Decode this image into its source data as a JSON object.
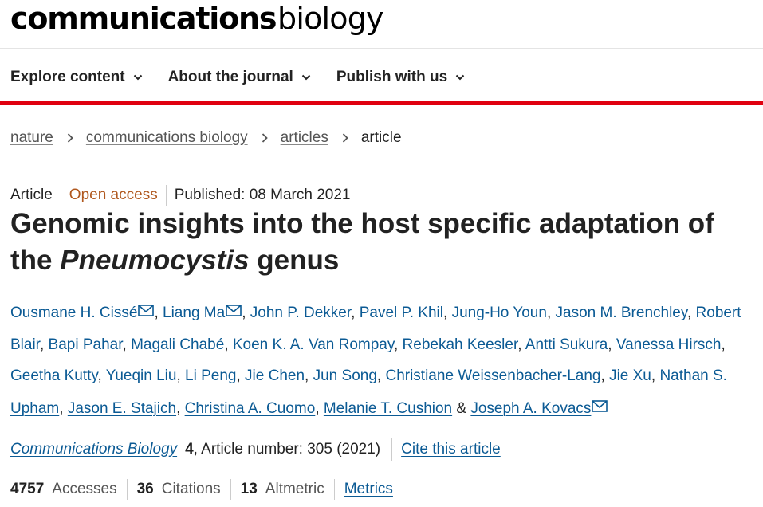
{
  "brand": {
    "bold": "communications",
    "light": "biology"
  },
  "menu": [
    {
      "label": "Explore content"
    },
    {
      "label": "About the journal"
    },
    {
      "label": "Publish with us"
    }
  ],
  "breadcrumb": [
    "nature",
    "communications biology",
    "articles",
    "article"
  ],
  "meta": {
    "type": "Article",
    "access": "Open access",
    "published": "Published: 08 March 2021"
  },
  "title": {
    "before": "Genomic insights into the host specific adaptation of the ",
    "italic": "Pneumocystis",
    "after": " genus"
  },
  "authors": [
    {
      "name": "Ousmane H. Cissé",
      "mail": true
    },
    {
      "name": "Liang Ma",
      "mail": true
    },
    {
      "name": "John P. Dekker"
    },
    {
      "name": "Pavel P. Khil"
    },
    {
      "name": "Jung-Ho Youn"
    },
    {
      "name": "Jason M. Brenchley"
    },
    {
      "name": "Robert Blair"
    },
    {
      "name": "Bapi Pahar"
    },
    {
      "name": "Magali Chabé"
    },
    {
      "name": "Koen K. A. Van Rompay"
    },
    {
      "name": "Rebekah Keesler"
    },
    {
      "name": "Antti Sukura"
    },
    {
      "name": "Vanessa Hirsch"
    },
    {
      "name": "Geetha Kutty"
    },
    {
      "name": "Yueqin Liu"
    },
    {
      "name": "Li Peng"
    },
    {
      "name": "Jie Chen"
    },
    {
      "name": "Jun Song"
    },
    {
      "name": "Christiane Weissenbacher-Lang"
    },
    {
      "name": "Jie Xu"
    },
    {
      "name": "Nathan S. Upham"
    },
    {
      "name": "Jason E. Stajich"
    },
    {
      "name": "Christina A. Cuomo"
    },
    {
      "name": "Melanie T. Cushion"
    },
    {
      "name": "Joseph A. Kovacs",
      "mail": true
    }
  ],
  "citation": {
    "journal": "Communications Biology",
    "volume": "4",
    "article_number": ", Article number: 305 (2021)",
    "cite_label": "Cite this article"
  },
  "metrics": {
    "accesses": "4757",
    "accesses_label": "Accesses",
    "citations": "36",
    "citations_label": "Citations",
    "altmetric": "13",
    "altmetric_label": "Altmetric",
    "metrics_label": "Metrics"
  },
  "colors": {
    "accent_red": "#e0000f",
    "link_blue": "#0b5a94",
    "open_access": "#b0581e"
  }
}
